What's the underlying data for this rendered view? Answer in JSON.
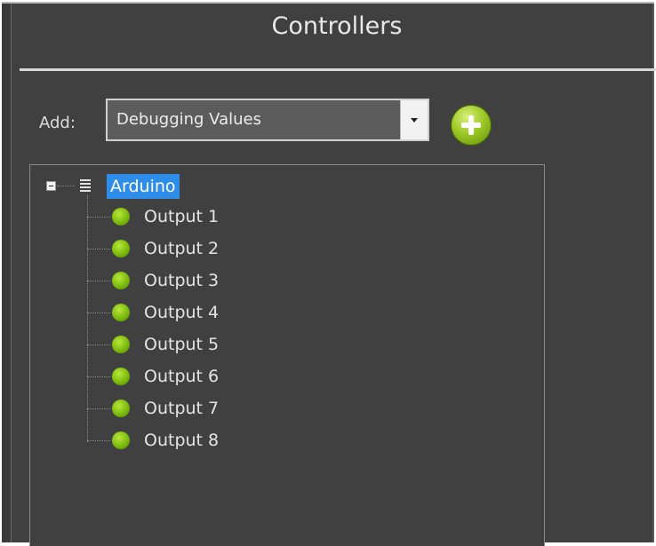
{
  "panel": {
    "title": "Controllers"
  },
  "add": {
    "label": "Add:",
    "selected": "Debugging Values",
    "button_icon": "add-circle-icon"
  },
  "tree": {
    "root": {
      "label": "Arduino",
      "icon": "list-icon",
      "expanded": true
    },
    "items": [
      {
        "label": "Output 1",
        "icon": "green-led-icon"
      },
      {
        "label": "Output 2",
        "icon": "green-led-icon"
      },
      {
        "label": "Output 3",
        "icon": "green-led-icon"
      },
      {
        "label": "Output 4",
        "icon": "green-led-icon"
      },
      {
        "label": "Output 5",
        "icon": "green-led-icon"
      },
      {
        "label": "Output 6",
        "icon": "green-led-icon"
      },
      {
        "label": "Output 7",
        "icon": "green-led-icon"
      },
      {
        "label": "Output 8",
        "icon": "green-led-icon"
      }
    ]
  },
  "colors": {
    "panel_bg": "#404040",
    "selection": "#2e8de8",
    "led_green": "#7cba0e",
    "text": "#e4e4e4"
  }
}
